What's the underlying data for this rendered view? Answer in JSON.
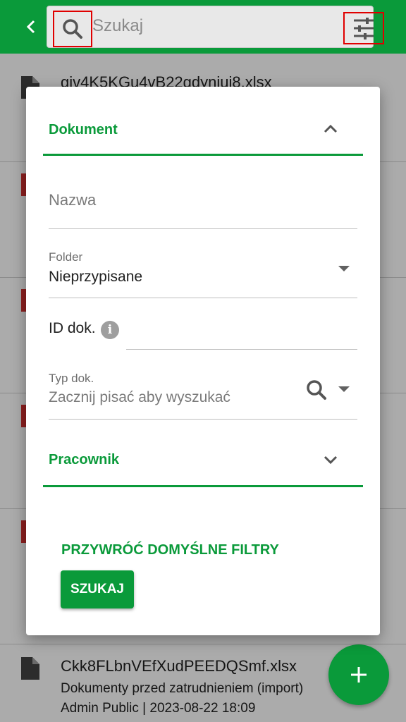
{
  "search": {
    "placeholder": "Szukaj"
  },
  "list": {
    "items": [
      {
        "title": "giv4K5KGu4vB22gdynjuj8.xlsx",
        "icon": "file-icon"
      },
      {
        "icon": "pdf-icon"
      },
      {
        "icon": "pdf-icon"
      },
      {
        "icon": "pdf-icon"
      },
      {
        "icon": "pdf-icon"
      },
      {
        "title": "Ckk8FLbnVEfXudPEEDQSmf.xlsx",
        "subtitle": "Dokumenty przed zatrudnieniem (import)",
        "meta": "Admin Public | 2023-08-22 18:09",
        "icon": "file-icon"
      }
    ]
  },
  "dialog": {
    "section_document": "Dokument",
    "name_placeholder": "Nazwa",
    "folder_label": "Folder",
    "folder_value": "Nieprzypisane",
    "doc_id_label": "ID dok.",
    "doc_type_label": "Typ dok.",
    "doc_type_placeholder": "Zacznij pisać aby wyszukać",
    "section_employee": "Pracownik",
    "reset_label": "PRZYWRÓĆ DOMYŚLNE FILTRY",
    "search_label": "SZUKAJ"
  },
  "colors": {
    "accent": "#0a9a3a",
    "highlight": "#e00000",
    "pdf": "#d32f2f"
  }
}
